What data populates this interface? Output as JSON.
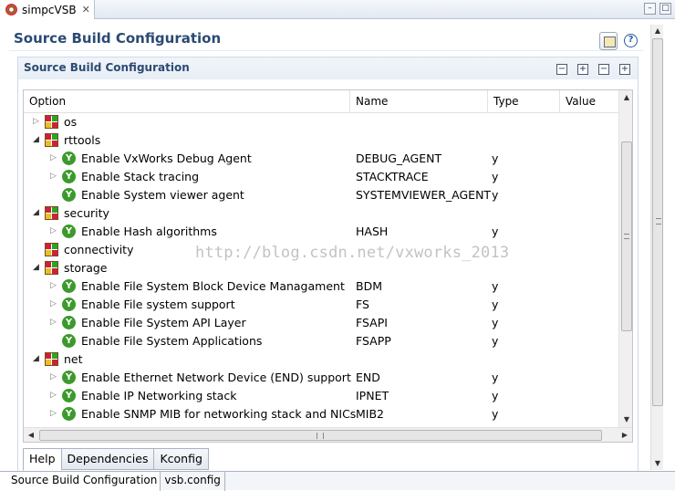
{
  "editor_tab": {
    "title": "simpcVSB",
    "close": "✕"
  },
  "page": {
    "title": "Source Build Configuration",
    "help": "?"
  },
  "section": {
    "title": "Source Build Configuration"
  },
  "table": {
    "columns": {
      "option": "Option",
      "name": "Name",
      "type": "Type",
      "value": "Value"
    },
    "rows": [
      {
        "level": 0,
        "kind": "folder",
        "expander": "collapsed",
        "label": "os",
        "name": "",
        "type": ""
      },
      {
        "level": 0,
        "kind": "folder",
        "expander": "expanded",
        "label": "rttools",
        "name": "",
        "type": ""
      },
      {
        "level": 1,
        "kind": "y",
        "expander": "collapsed",
        "label": "Enable VxWorks Debug Agent",
        "name": "DEBUG_AGENT",
        "type": "y"
      },
      {
        "level": 1,
        "kind": "y",
        "expander": "collapsed",
        "label": "Enable Stack tracing",
        "name": "STACKTRACE",
        "type": "y"
      },
      {
        "level": 1,
        "kind": "y",
        "expander": "none",
        "label": "Enable System viewer agent",
        "name": "SYSTEMVIEWER_AGENT",
        "type": "y"
      },
      {
        "level": 0,
        "kind": "folder",
        "expander": "expanded",
        "label": "security",
        "name": "",
        "type": ""
      },
      {
        "level": 1,
        "kind": "y",
        "expander": "collapsed",
        "label": "Enable Hash algorithms",
        "name": "HASH",
        "type": "y"
      },
      {
        "level": 0,
        "kind": "folder",
        "expander": "none",
        "label": "connectivity",
        "name": "",
        "type": ""
      },
      {
        "level": 0,
        "kind": "folder",
        "expander": "expanded",
        "label": "storage",
        "name": "",
        "type": ""
      },
      {
        "level": 1,
        "kind": "y",
        "expander": "collapsed",
        "label": "Enable File System Block Device Managament",
        "name": "BDM",
        "type": "y"
      },
      {
        "level": 1,
        "kind": "y",
        "expander": "collapsed",
        "label": "Enable File system support",
        "name": "FS",
        "type": "y"
      },
      {
        "level": 1,
        "kind": "y",
        "expander": "collapsed",
        "label": "Enable File System API Layer",
        "name": "FSAPI",
        "type": "y"
      },
      {
        "level": 1,
        "kind": "y",
        "expander": "none",
        "label": "Enable File System Applications",
        "name": "FSAPP",
        "type": "y"
      },
      {
        "level": 0,
        "kind": "folder",
        "expander": "expanded",
        "label": "net",
        "name": "",
        "type": ""
      },
      {
        "level": 1,
        "kind": "y",
        "expander": "collapsed",
        "label": "Enable Ethernet Network Device (END) support",
        "name": "END",
        "type": "y"
      },
      {
        "level": 1,
        "kind": "y",
        "expander": "collapsed",
        "label": "Enable IP Networking stack",
        "name": "IPNET",
        "type": "y"
      },
      {
        "level": 1,
        "kind": "y",
        "expander": "collapsed",
        "label": "Enable SNMP MIB for networking stack and NICs",
        "name": "MIB2",
        "type": "y"
      }
    ],
    "icon_glyph": "Y",
    "hscroll_grip": "III"
  },
  "watermark": "http://blog.csdn.net/vxworks_2013",
  "subtabs": [
    "Help",
    "Dependencies",
    "Kconfig"
  ],
  "bottom_tabs": [
    "Source Build Configuration",
    "vsb.config"
  ],
  "colors": {
    "title": "#2b4a73",
    "y_icon": "#3c9a2c"
  }
}
